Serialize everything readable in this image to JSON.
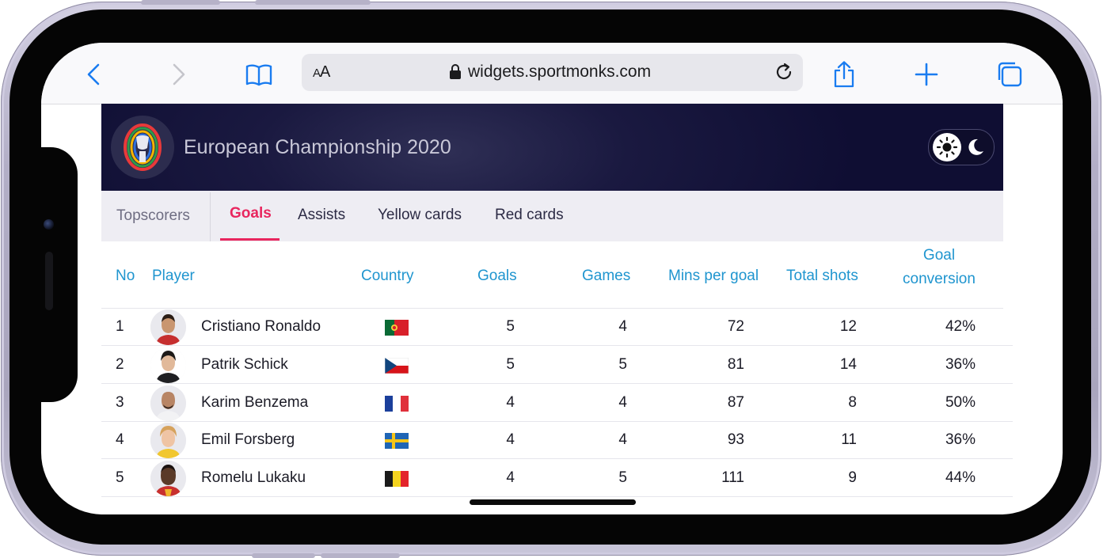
{
  "browser": {
    "aa_label_small": "A",
    "aa_label_large": "A",
    "url": "widgets.sportmonks.com",
    "accent_color": "#1a7cf0"
  },
  "widget": {
    "title": "European Championship 2020",
    "theme": {
      "current": "light",
      "options": [
        "sun-icon",
        "moon-icon"
      ]
    },
    "section_label": "Topscorers",
    "tabs": [
      {
        "label": "Goals",
        "active": true
      },
      {
        "label": "Assists",
        "active": false
      },
      {
        "label": "Yellow cards",
        "active": false
      },
      {
        "label": "Red cards",
        "active": false
      }
    ],
    "accent_color": "#e8265e",
    "header_color": "#1f95cf",
    "columns": {
      "no": "No",
      "player": "Player",
      "country": "Country",
      "goals": "Goals",
      "games": "Games",
      "mins_per_goal": "Mins per goal",
      "total_shots": "Total shots",
      "goal_conversion_line1": "Goal",
      "goal_conversion_line2": "conversion"
    },
    "rows": [
      {
        "no": "1",
        "player": "Cristiano Ronaldo",
        "country_flag": "portugal-flag",
        "goals": "5",
        "games": "4",
        "mins_per_goal": "72",
        "total_shots": "12",
        "goal_conversion": "42%"
      },
      {
        "no": "2",
        "player": "Patrik Schick",
        "country_flag": "czech-republic-flag",
        "goals": "5",
        "games": "5",
        "mins_per_goal": "81",
        "total_shots": "14",
        "goal_conversion": "36%"
      },
      {
        "no": "3",
        "player": "Karim Benzema",
        "country_flag": "france-flag",
        "goals": "4",
        "games": "4",
        "mins_per_goal": "87",
        "total_shots": "8",
        "goal_conversion": "50%"
      },
      {
        "no": "4",
        "player": "Emil Forsberg",
        "country_flag": "sweden-flag",
        "goals": "4",
        "games": "4",
        "mins_per_goal": "93",
        "total_shots": "11",
        "goal_conversion": "36%"
      },
      {
        "no": "5",
        "player": "Romelu Lukaku",
        "country_flag": "belgium-flag",
        "goals": "4",
        "games": "5",
        "mins_per_goal": "111",
        "total_shots": "9",
        "goal_conversion": "44%"
      }
    ]
  }
}
